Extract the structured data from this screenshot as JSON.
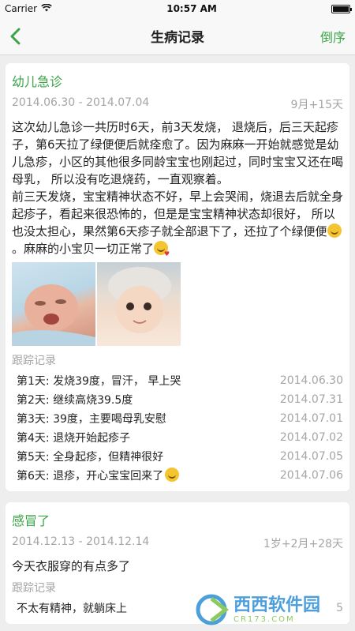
{
  "status_bar": {
    "carrier": "Carrier",
    "time": "10:57 AM",
    "battery_level": 1.0
  },
  "nav": {
    "title": "生病记录",
    "sort_label": "倒序",
    "back_icon": "chevron-left-icon"
  },
  "colors": {
    "accent": "#3aa447",
    "muted": "#a5a5a5",
    "background": "#eeeeee"
  },
  "records": [
    {
      "title": "幼儿急诊",
      "date_range": "2014.06.30 - 2014.07.04",
      "age": "9月+15天",
      "description_1": "这次幼儿急诊一共历时6天，前3天发烧， 退烧后，后三天起疹子，第6天拉了绿便便后就痊愈了。因为麻麻一开始就感觉是幼儿急疹，小区的其他很多同龄宝宝也刚起过，同时宝宝又还在喝母乳， 所以没有吃退烧药，一直观察着。",
      "description_2a": "前三天发烧，宝宝精神状态不好，早上会哭闹，烧退去后就全身起疹子，看起来很恐怖的，但是是宝宝精神状态却很好， 所以也没太担心，果然第6天疹子就全部退下了，还拉了个绿便便",
      "description_2b": "。麻麻的小宝贝一切正常了",
      "track_label": "跟踪记录",
      "tracks": [
        {
          "text": "第1天: 发烧39度，冒汗， 早上哭",
          "date": "2014.06.30"
        },
        {
          "text": "第2天: 继续高烧39.5度",
          "date": "2014.07.31"
        },
        {
          "text": "第3天: 39度，主要喝母乳安慰",
          "date": "2014.07.01"
        },
        {
          "text": "第4天: 退烧开始起疹子",
          "date": "2014.07.02"
        },
        {
          "text": "第5天: 全身起疹，但精神很好",
          "date": "2014.07.05"
        },
        {
          "text": "第6天: 退疹，开心宝宝回来了",
          "date": "2014.07.06"
        }
      ]
    },
    {
      "title": "感冒了",
      "date_range": "2014.12.13 - 2014.12.14",
      "age": "1岁+2月+28天",
      "description": "今天衣服穿的有点多了",
      "track_label": "跟踪记录",
      "tracks": [
        {
          "text": "不太有精神，就躺床上",
          "date": "5"
        }
      ]
    }
  ],
  "watermark": {
    "site_name": "西西软件园",
    "domain": "CR173.COM"
  }
}
